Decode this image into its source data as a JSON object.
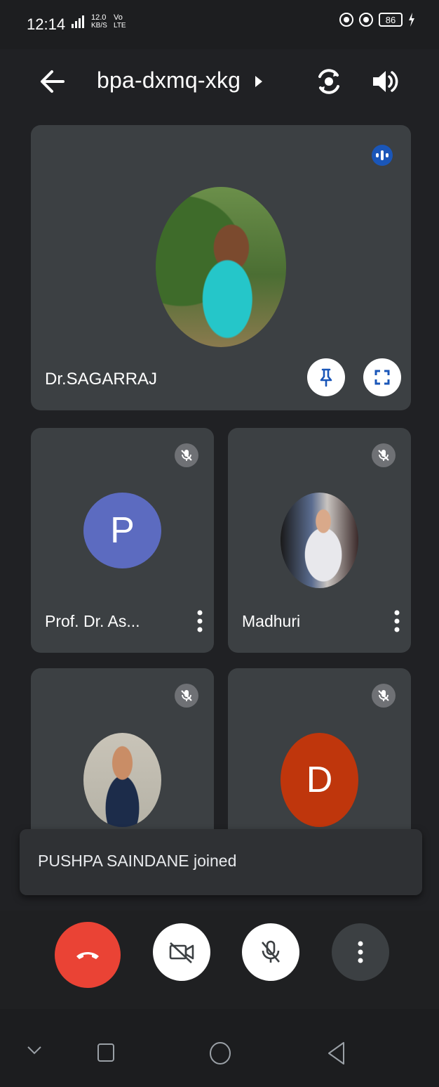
{
  "status_bar": {
    "time": "12:14",
    "network_top": "12.0",
    "network_bottom": "KB/S",
    "lte_top": "Vo",
    "lte_bottom": "LTE",
    "battery": "86"
  },
  "header": {
    "meeting_code": "bpa-dxmq-xkg"
  },
  "main_tile": {
    "name": "Dr.SAGARRAJ"
  },
  "participants": [
    {
      "name": "Prof. Dr. As...",
      "avatar_letter": "P",
      "avatar_color": "#5c6bc0"
    },
    {
      "name": "Madhuri"
    },
    {
      "name": ""
    },
    {
      "name": "",
      "avatar_letter": "D",
      "avatar_color": "#bf360c"
    }
  ],
  "toast": {
    "message": "PUSHPA SAINDANE joined"
  },
  "colors": {
    "end_call": "#ea4335",
    "speaking": "#1a56b8",
    "tile_bg": "#3c4043"
  }
}
